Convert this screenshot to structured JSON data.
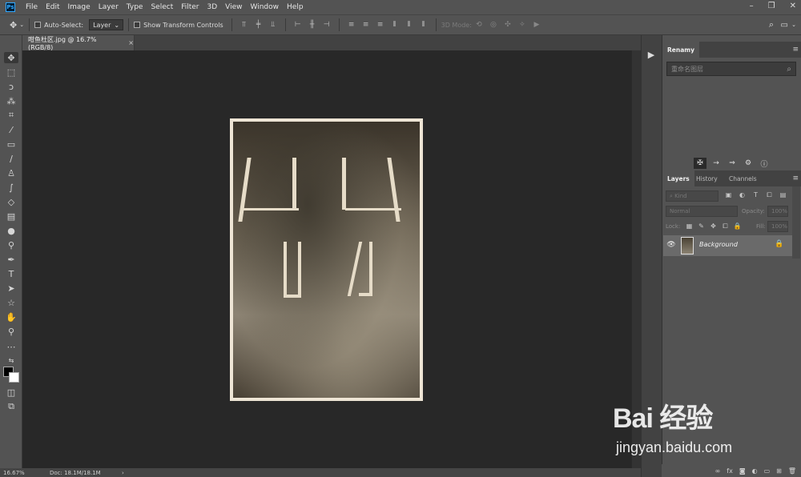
{
  "app": {
    "logo": "Ps"
  },
  "menu": [
    "File",
    "Edit",
    "Image",
    "Layer",
    "Type",
    "Select",
    "Filter",
    "3D",
    "View",
    "Window",
    "Help"
  ],
  "window_controls": [
    "–",
    "❐",
    "✕"
  ],
  "options": {
    "auto_select_label": "Auto-Select:",
    "auto_select_value": "Layer",
    "show_transform_label": "Show Transform Controls",
    "mode_3d_label": "3D Mode:"
  },
  "document": {
    "tab_title": "咁鱼杜区.jpg @ 16.7% (RGB/8)",
    "close": "×"
  },
  "status": {
    "zoom": "16.67%",
    "doc_info": "Doc: 18.1M/18.1M",
    "arrow": "›"
  },
  "renamy": {
    "title": "Renamy",
    "placeholder": "重命名图层"
  },
  "layers_panel": {
    "tabs": [
      "Layers",
      "History",
      "Channels"
    ],
    "kind_label": "Kind",
    "blend_mode": "Normal",
    "opacity_label": "Opacity:",
    "opacity_value": "100%",
    "lock_label": "Lock:",
    "fill_label": "Fill:",
    "fill_value": "100%",
    "layers": [
      {
        "name": "Background",
        "visible": true,
        "locked": true
      }
    ],
    "footer_icons": [
      "∞",
      "fx",
      "◙",
      "◐",
      "▭",
      "⊞",
      "🗑"
    ]
  },
  "watermark": {
    "brand": "Bai 经验",
    "url": "jingyan.baidu.com"
  }
}
